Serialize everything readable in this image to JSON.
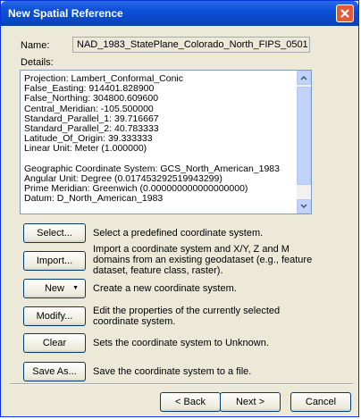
{
  "window": {
    "title": "New Spatial Reference"
  },
  "name": {
    "label": "Name:",
    "value": "NAD_1983_StatePlane_Colorado_North_FIPS_0501"
  },
  "details": {
    "label": "Details:",
    "lines": [
      "Projection: Lambert_Conformal_Conic",
      "False_Easting: 914401.828900",
      "False_Northing: 304800.609600",
      "Central_Meridian: -105.500000",
      "Standard_Parallel_1: 39.716667",
      "Standard_Parallel_2: 40.783333",
      "Latitude_Of_Origin: 39.333333",
      "Linear Unit: Meter (1.000000)",
      "",
      "Geographic Coordinate System: GCS_North_American_1983",
      "Angular Unit: Degree (0.017453292519943299)",
      "Prime Meridian: Greenwich (0.000000000000000000)",
      "Datum: D_North_American_1983"
    ]
  },
  "actions": [
    {
      "label": "Select...",
      "desc": "Select a predefined coordinate system."
    },
    {
      "label": "Import...",
      "desc": "Import a coordinate system and X/Y, Z and M domains from an existing geodataset (e.g., feature dataset, feature class, raster)."
    },
    {
      "label": "New",
      "desc": "Create a new coordinate system."
    },
    {
      "label": "Modify...",
      "desc": "Edit the properties of the currently selected coordinate system."
    },
    {
      "label": "Clear",
      "desc": "Sets the coordinate system to Unknown."
    },
    {
      "label": "Save As...",
      "desc": "Save the coordinate system to a file."
    }
  ],
  "footer": {
    "back": "< Back",
    "next": "Next >",
    "cancel": "Cancel"
  }
}
